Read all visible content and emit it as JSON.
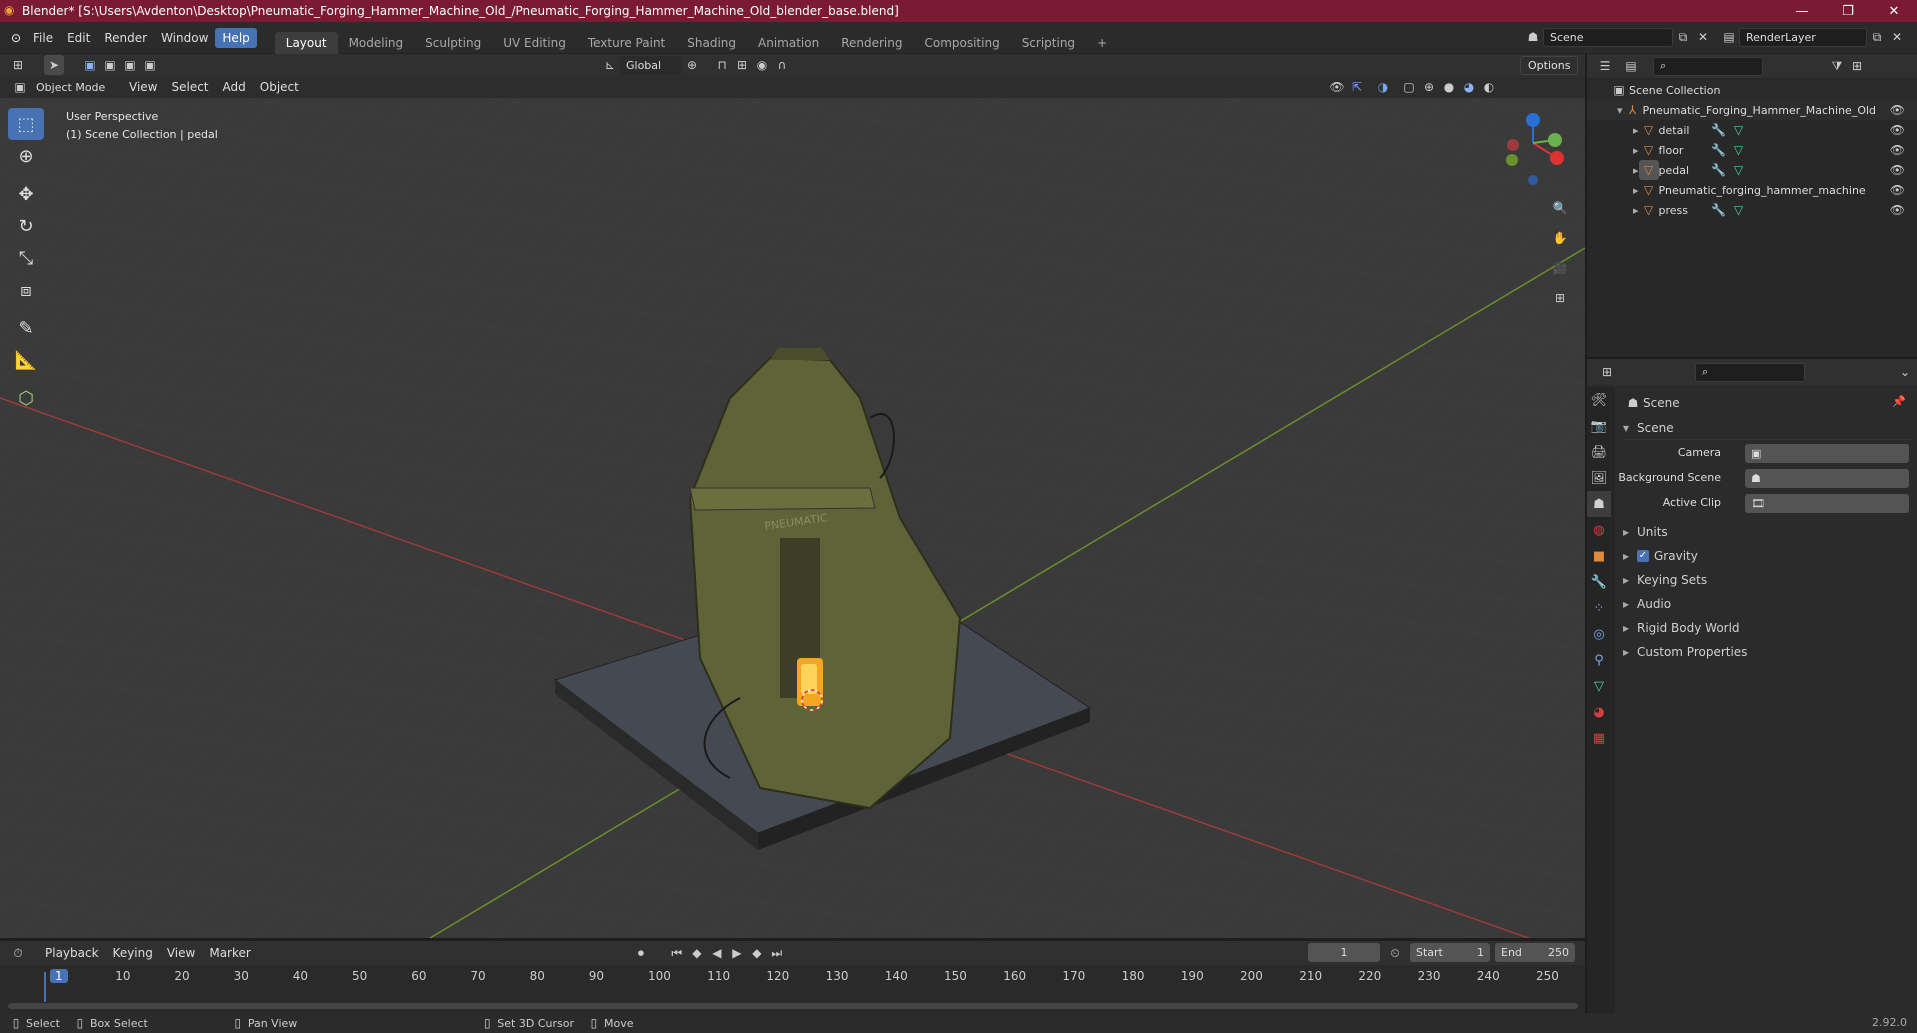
{
  "titlebar": {
    "title": "Blender* [S:\\Users\\Avdenton\\Desktop\\Pneumatic_Forging_Hammer_Machine_Old_/Pneumatic_Forging_Hammer_Machine_Old_blender_base.blend]"
  },
  "menus": [
    "File",
    "Edit",
    "Render",
    "Window",
    "Help"
  ],
  "workspace_tabs": [
    "Layout",
    "Modeling",
    "Sculpting",
    "UV Editing",
    "Texture Paint",
    "Shading",
    "Animation",
    "Rendering",
    "Compositing",
    "Scripting"
  ],
  "scene": {
    "name": "Scene",
    "render_layer": "RenderLayer"
  },
  "toolbar": {
    "orientation": "Global",
    "options": "Options"
  },
  "viewport_header": {
    "mode": "Object Mode",
    "menus": [
      "View",
      "Select",
      "Add",
      "Object"
    ]
  },
  "viewport": {
    "perspective": "User Perspective",
    "collection_info": "(1) Scene Collection | pedal",
    "label_text": "PNEUMATIC"
  },
  "outliner": {
    "root": "Scene Collection",
    "collection": "Pneumatic_Forging_Hammer_Machine_Old",
    "items": [
      "detail",
      "floor",
      "pedal",
      "Pneumatic_forging_hammer_machine",
      "press"
    ]
  },
  "properties": {
    "header": "Scene",
    "section": "Scene",
    "fields": {
      "camera": "Camera",
      "background_scene": "Background Scene",
      "active_clip": "Active Clip"
    },
    "sections": [
      "Units",
      "Gravity",
      "Keying Sets",
      "Audio",
      "Rigid Body World",
      "Custom Properties"
    ]
  },
  "timeline": {
    "menus": [
      "Playback",
      "Keying",
      "View",
      "Marker"
    ],
    "current_frame": "1",
    "start_label": "Start",
    "start": "1",
    "end_label": "End",
    "end": "250",
    "ticks": [
      "1",
      "10",
      "20",
      "30",
      "40",
      "50",
      "60",
      "70",
      "80",
      "90",
      "100",
      "110",
      "120",
      "130",
      "140",
      "150",
      "160",
      "170",
      "180",
      "190",
      "200",
      "210",
      "220",
      "230",
      "240",
      "250"
    ]
  },
  "statusbar": {
    "select": "Select",
    "box_select": "Box Select",
    "pan_view": "Pan View",
    "set_cursor": "Set 3D Cursor",
    "move": "Move",
    "version": "2.92.0"
  }
}
